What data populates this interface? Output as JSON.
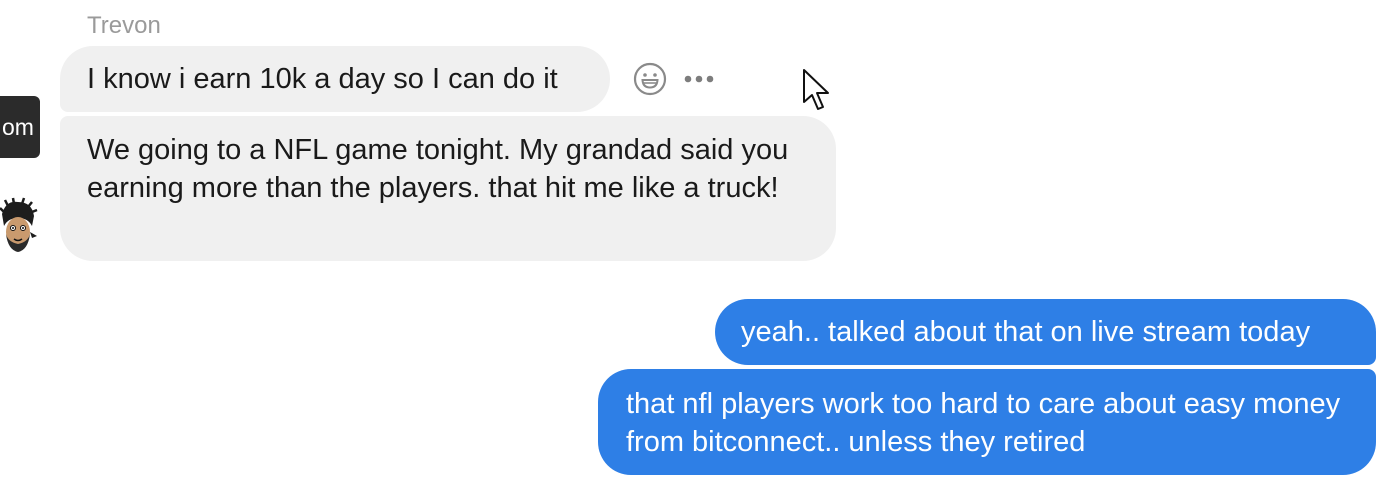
{
  "tooltip": {
    "text": "om"
  },
  "sender": {
    "name": "Trevon"
  },
  "messages": {
    "incoming_1": "I know i earn 10k a day so I can do it",
    "incoming_2": "We going to a NFL game tonight. My grandad said you earning more than the players. that hit me like a truck!",
    "outgoing_1": "yeah.. talked about that on live stream today",
    "outgoing_2": "that nfl players work too hard to care about easy money from bitconnect.. unless they retired"
  },
  "icons": {
    "reaction": "smiley-face-icon",
    "more": "more-options-icon",
    "cursor": "mouse-pointer-icon",
    "avatar": "cartoon-avatar"
  },
  "colors": {
    "incoming_bubble": "#f0f0f0",
    "outgoing_bubble": "#2e7fe6",
    "sender_name": "#9a9a9a",
    "tooltip_bg": "#2b2b2b"
  }
}
